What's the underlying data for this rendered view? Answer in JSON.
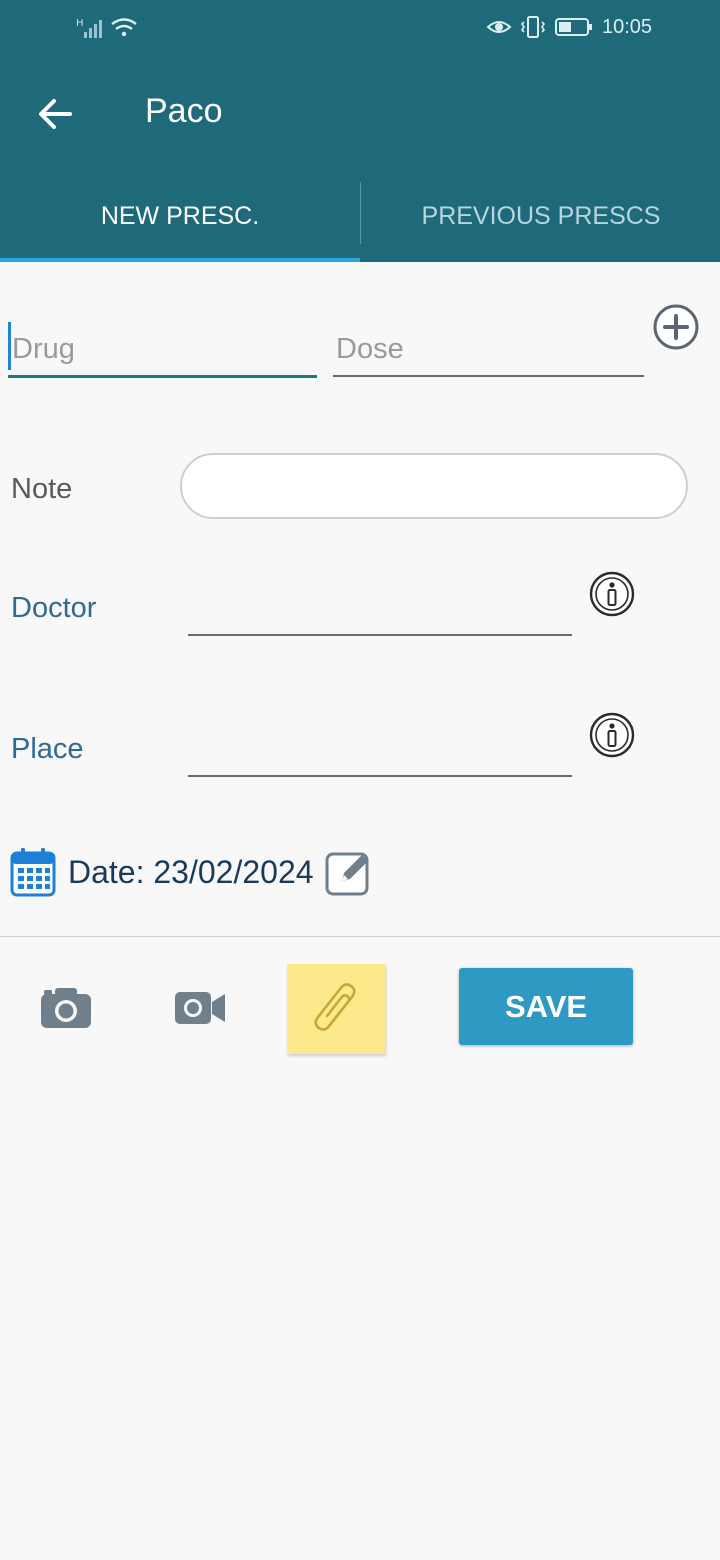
{
  "status_bar": {
    "network_label": "H",
    "time": "10:05",
    "icons": [
      "signal-icon",
      "wifi-icon",
      "eye-icon",
      "vibrate-icon",
      "battery-icon"
    ]
  },
  "app_bar": {
    "title": "Paco",
    "back_icon": "arrow-left-icon"
  },
  "tabs": [
    {
      "label": "NEW PRESC.",
      "active": true
    },
    {
      "label": "PREVIOUS PRESCS",
      "active": false
    }
  ],
  "form": {
    "drug_placeholder": "Drug",
    "drug_value": "",
    "dose_placeholder": "Dose",
    "dose_value": "",
    "add_icon": "plus-circle-icon",
    "note_label": "Note",
    "note_value": "",
    "doctor_label": "Doctor",
    "doctor_value": "",
    "place_label": "Place",
    "place_value": "",
    "info_icon": "info-circle-icon",
    "date_label": "Date: 23/02/2024",
    "calendar_icon": "calendar-icon",
    "edit_icon": "edit-icon"
  },
  "actions": {
    "camera_icon": "camera-icon",
    "video_icon": "video-camera-icon",
    "attach_icon": "paperclip-icon",
    "save_label": "SAVE"
  },
  "colors": {
    "header_bg": "#1e6a7b",
    "tab_indicator": "#27a6e0",
    "label_blue": "#2f6996",
    "save_bg": "#2e9ac4",
    "attach_bg": "#fbe98b",
    "icon_gray": "#6f7f8c"
  }
}
